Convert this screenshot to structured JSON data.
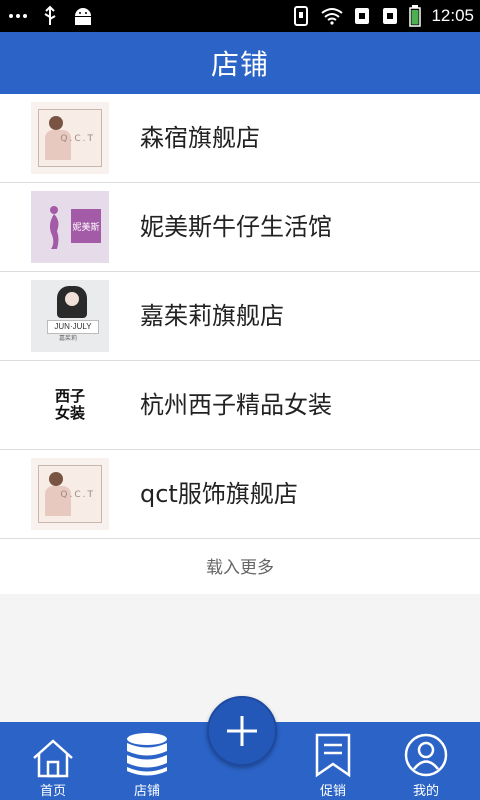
{
  "status_bar": {
    "time": "12:05",
    "left_icons": [
      "more-dots-icon",
      "usb-icon",
      "android-icon"
    ],
    "right_icons": [
      "phone-icon",
      "wifi-icon",
      "sim1-icon",
      "sim2-icon",
      "battery-icon"
    ]
  },
  "header": {
    "title": "店铺"
  },
  "stores": [
    {
      "name": "森宿旗舰店",
      "thumb": "photo"
    },
    {
      "name": "妮美斯牛仔生活馆",
      "thumb": "purple",
      "thumb_text": "妮美斯"
    },
    {
      "name": "嘉茱莉旗舰店",
      "thumb": "gray",
      "thumb_text": "JUN·JULY",
      "thumb_sub": "嘉茱莉"
    },
    {
      "name": "杭州西子精品女装",
      "thumb": "text",
      "thumb_line1": "西子",
      "thumb_line2": "女装"
    },
    {
      "name": "qct服饰旗舰店",
      "thumb": "photo"
    }
  ],
  "load_more": "载入更多",
  "bottom_nav": {
    "home": "首页",
    "stores": "店铺",
    "promo": "促销",
    "mine": "我的",
    "add_icon": "plus-icon"
  },
  "colors": {
    "primary": "#2b63c7",
    "fab": "#2458b8"
  }
}
